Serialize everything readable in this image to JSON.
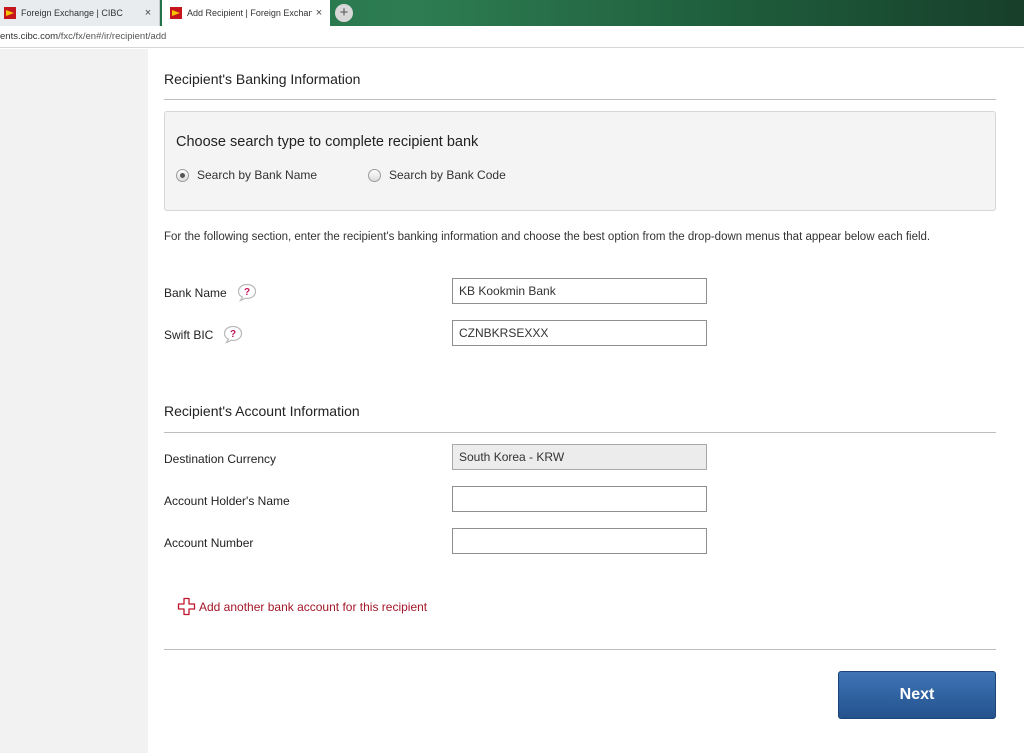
{
  "browser": {
    "tabs": [
      {
        "label": "Foreign Exchange | CIBC"
      },
      {
        "label": "Add Recipient | Foreign Exchange"
      }
    ],
    "close_glyph": "×",
    "new_tab_glyph": "+",
    "url_prefix": "ents.cibc.com",
    "url_path": "/fxc/fx/en#/ir/recipient/add"
  },
  "banking": {
    "title": "Recipient's Banking Information",
    "search": {
      "heading": "Choose search type to complete recipient bank",
      "options": [
        {
          "label": "Search by Bank Name",
          "selected": true
        },
        {
          "label": "Search by Bank Code",
          "selected": false
        }
      ]
    },
    "instructions": "For the following section, enter the recipient's banking information and choose the best option from the drop-down menus that appear below each field.",
    "fields": {
      "bank_name": {
        "label": "Bank Name",
        "value": "KB Kookmin Bank"
      },
      "swift_bic": {
        "label": "Swift BIC",
        "value": "CZNBKRSEXXX"
      }
    }
  },
  "account": {
    "title": "Recipient's Account Information",
    "fields": {
      "currency": {
        "label": "Destination Currency",
        "value": "South Korea - KRW"
      },
      "holder_name": {
        "label": "Account Holder's Name",
        "value": ""
      },
      "account_number": {
        "label": "Account Number",
        "value": ""
      }
    },
    "add_account_label": "Add another bank account for this recipient"
  },
  "actions": {
    "next_label": "Next"
  },
  "colors": {
    "accent_red": "#a31727",
    "button_blue": "#2f62a3"
  },
  "icons": [
    "help-icon",
    "plus-icon",
    "radio-icon",
    "close-icon",
    "new-tab-icon",
    "cibc-logo-icon"
  ]
}
